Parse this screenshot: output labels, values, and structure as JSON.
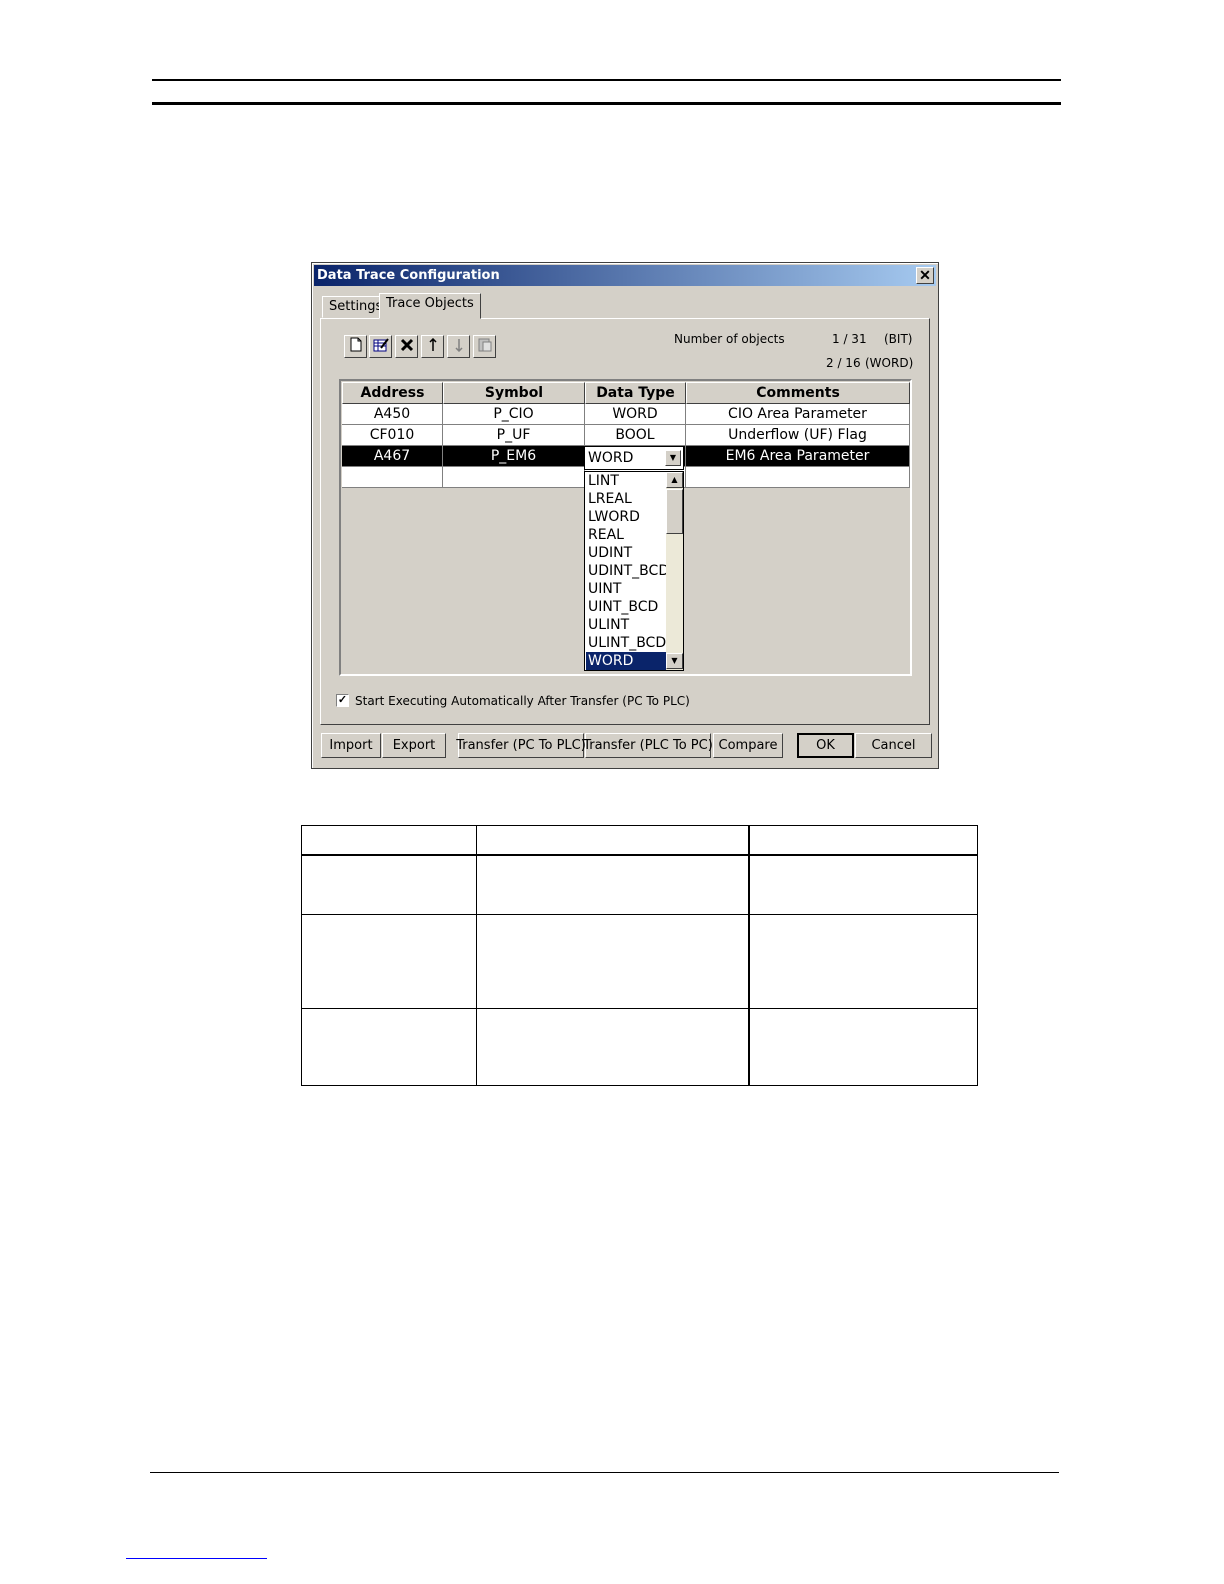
{
  "dialog": {
    "title": "Data Trace Configuration",
    "close_glyph": "✕",
    "tabs": [
      {
        "label": "Settings"
      },
      {
        "label": "Trace Objects"
      }
    ],
    "toolbar": {
      "new": "new-icon",
      "edit": "edit-icon",
      "delete": "delete-icon",
      "up": "arrow-up-icon",
      "down": "arrow-down-icon",
      "paste": "paste-icon"
    },
    "objects_label": "Number of objects",
    "count_bit": "1 / 31",
    "bit_unit": "(BIT)",
    "count_word": "2 / 16",
    "word_unit": "(WORD)",
    "columns": [
      "Address",
      "Symbol",
      "Data Type",
      "Comments"
    ],
    "rows": [
      {
        "address": "A450",
        "symbol": "P_CIO",
        "type": "WORD",
        "comment": "CIO Area Parameter"
      },
      {
        "address": "CF010",
        "symbol": "P_UF",
        "type": "BOOL",
        "comment": "Underflow (UF) Flag"
      },
      {
        "address": "A467",
        "symbol": "P_EM6",
        "type": "WORD",
        "comment": "EM6 Area Parameter"
      },
      {
        "address": "",
        "symbol": "",
        "type": "",
        "comment": ""
      }
    ],
    "combo_value": "WORD",
    "dropdown_options": [
      "LINT",
      "LREAL",
      "LWORD",
      "REAL",
      "UDINT",
      "UDINT_BCD",
      "UINT",
      "UINT_BCD",
      "ULINT",
      "ULINT_BCD",
      "WORD"
    ],
    "dropdown_selected": "WORD",
    "auto_start_label": "Start Executing Automatically After Transfer (PC To PLC)",
    "auto_start_checked": true,
    "buttons": {
      "import": "Import",
      "export": "Export",
      "transfer_pc_plc": "Transfer (PC To PLC)",
      "transfer_plc_pc": "Transfer (PLC To PC)",
      "compare": "Compare",
      "ok": "OK",
      "cancel": "Cancel"
    }
  }
}
